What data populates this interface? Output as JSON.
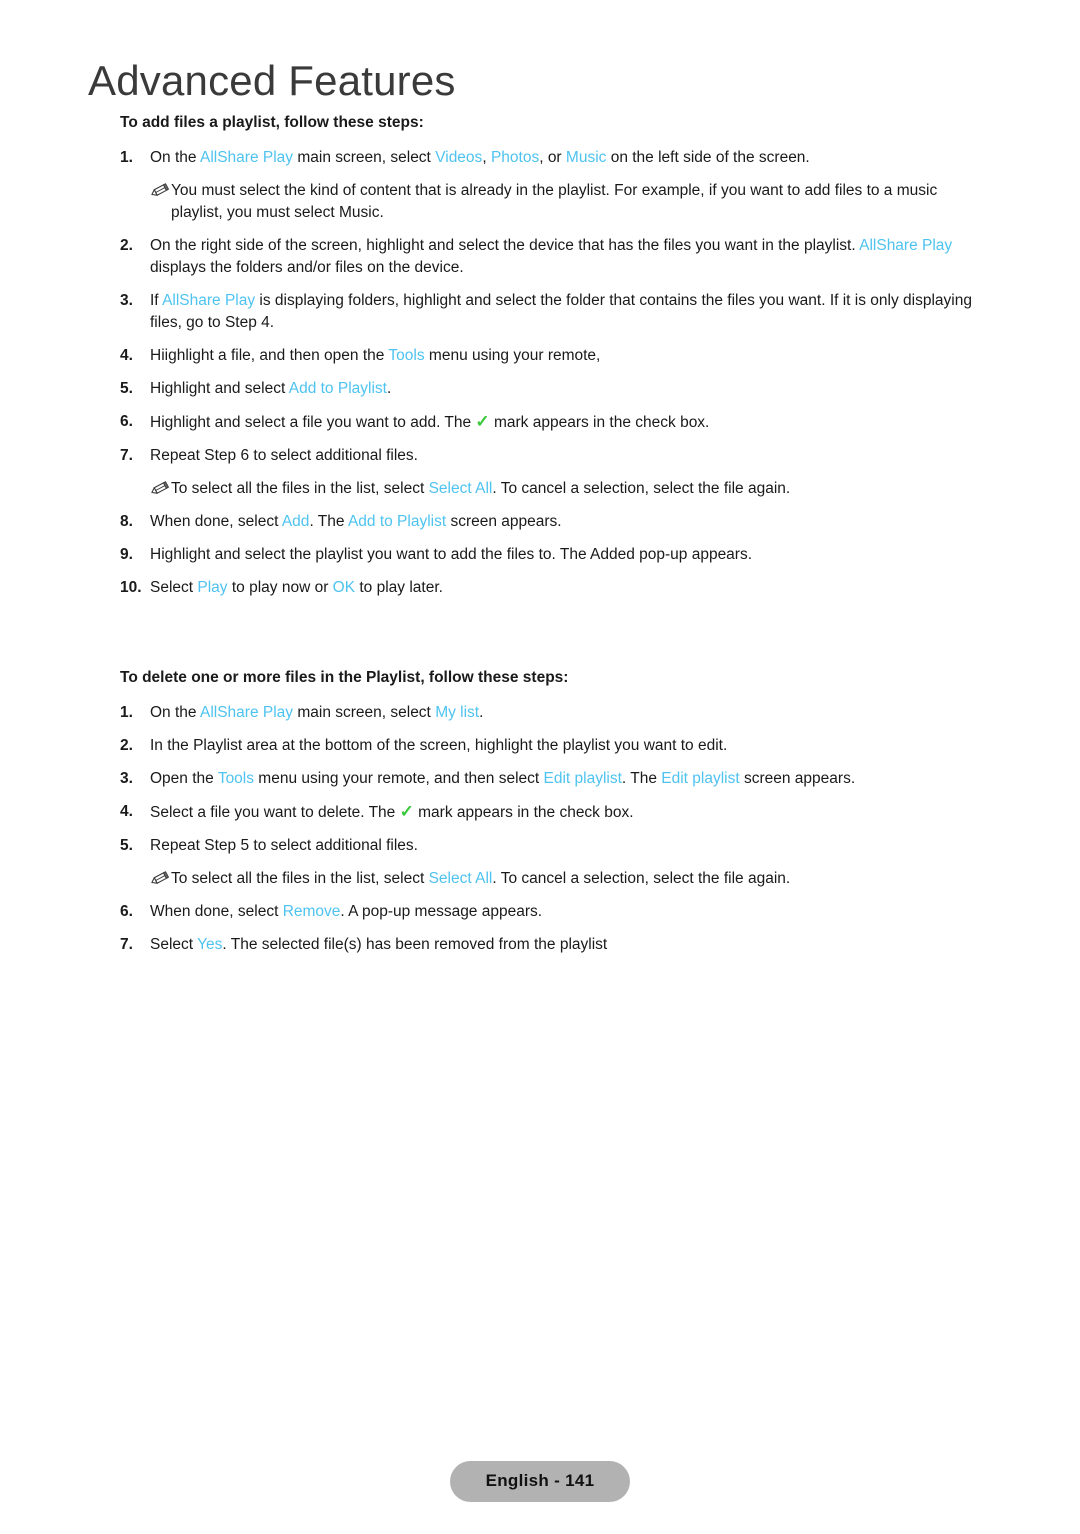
{
  "chapter": {
    "title": "Advanced Features"
  },
  "sections": [
    {
      "heading": "To add files a playlist, follow these steps:",
      "steps": [
        {
          "num": "1.",
          "parts": [
            {
              "t": "On the ",
              "c": "plain"
            },
            {
              "t": "AllShare Play",
              "c": "link"
            },
            {
              "t": " main screen, select ",
              "c": "plain"
            },
            {
              "t": "Videos",
              "c": "link"
            },
            {
              "t": ", ",
              "c": "plain"
            },
            {
              "t": "Photos",
              "c": "link"
            },
            {
              "t": ", or ",
              "c": "plain"
            },
            {
              "t": "Music",
              "c": "link"
            },
            {
              "t": " on the left side of the screen.",
              "c": "plain"
            }
          ]
        },
        {
          "note": true,
          "parts": [
            {
              "t": "You must select the kind of content that is already in the playlist. For example, if you want to add files to a music playlist, you must select Music.",
              "c": "plain"
            }
          ]
        },
        {
          "num": "2.",
          "parts": [
            {
              "t": "On the right side of the screen, highlight and select the device that has the files you want in the playlist. ",
              "c": "plain"
            },
            {
              "t": "AllShare Play",
              "c": "link"
            },
            {
              "t": " displays the folders and/or files on the device.",
              "c": "plain"
            }
          ]
        },
        {
          "num": "3.",
          "parts": [
            {
              "t": "If ",
              "c": "plain"
            },
            {
              "t": "AllShare Play",
              "c": "link"
            },
            {
              "t": " is displaying folders, highlight and select the folder that contains the files you want. If it is only displaying files, go to Step 4.",
              "c": "plain"
            }
          ]
        },
        {
          "num": "4.",
          "parts": [
            {
              "t": "Hiighlight a file, and then open the ",
              "c": "plain"
            },
            {
              "t": "Tools",
              "c": "link"
            },
            {
              "t": " menu using your remote,",
              "c": "plain"
            }
          ]
        },
        {
          "num": "5.",
          "parts": [
            {
              "t": "Highlight and select ",
              "c": "plain"
            },
            {
              "t": "Add to Playlist",
              "c": "link"
            },
            {
              "t": ".",
              "c": "plain"
            }
          ]
        },
        {
          "num": "6.",
          "parts": [
            {
              "t": "Highlight and select a file you want to add. The ",
              "c": "plain"
            },
            {
              "t": "✓",
              "c": "check"
            },
            {
              "t": " mark appears in the check box.",
              "c": "plain"
            }
          ]
        },
        {
          "num": "7.",
          "parts": [
            {
              "t": "Repeat Step 6 to select additional files.",
              "c": "plain"
            }
          ]
        },
        {
          "note": true,
          "parts": [
            {
              "t": "To select all the files in the list, select ",
              "c": "plain"
            },
            {
              "t": "Select All",
              "c": "link"
            },
            {
              "t": ". To cancel a selection, select the file again.",
              "c": "plain"
            }
          ]
        },
        {
          "num": "8.",
          "parts": [
            {
              "t": "When done, select ",
              "c": "plain"
            },
            {
              "t": "Add",
              "c": "link"
            },
            {
              "t": ". The ",
              "c": "plain"
            },
            {
              "t": "Add to Playlist",
              "c": "link"
            },
            {
              "t": " screen appears.",
              "c": "plain"
            }
          ]
        },
        {
          "num": "9.",
          "parts": [
            {
              "t": "Highlight and select the playlist you want to add the files to. The Added pop-up appears.",
              "c": "plain"
            }
          ]
        },
        {
          "num": "10.",
          "tight": true,
          "parts": [
            {
              "t": "Select ",
              "c": "plain"
            },
            {
              "t": "Play",
              "c": "link"
            },
            {
              "t": " to play now or ",
              "c": "plain"
            },
            {
              "t": "OK",
              "c": "link"
            },
            {
              "t": " to play later.",
              "c": "plain"
            }
          ]
        }
      ]
    },
    {
      "heading": "To delete one or more files in the Playlist, follow these steps:",
      "steps": [
        {
          "num": "1.",
          "parts": [
            {
              "t": "On the ",
              "c": "plain"
            },
            {
              "t": "AllShare Play",
              "c": "link"
            },
            {
              "t": " main screen, select ",
              "c": "plain"
            },
            {
              "t": "My list",
              "c": "link"
            },
            {
              "t": ".",
              "c": "plain"
            }
          ]
        },
        {
          "num": "2.",
          "parts": [
            {
              "t": "In the Playlist area at the bottom of the screen, highlight the playlist you want to edit.",
              "c": "plain"
            }
          ]
        },
        {
          "num": "3.",
          "parts": [
            {
              "t": "Open the ",
              "c": "plain"
            },
            {
              "t": "Tools",
              "c": "link"
            },
            {
              "t": " menu using your remote, and then select ",
              "c": "plain"
            },
            {
              "t": "Edit playlist",
              "c": "link"
            },
            {
              "t": ". The ",
              "c": "plain"
            },
            {
              "t": "Edit playlist",
              "c": "link"
            },
            {
              "t": " screen appears.",
              "c": "plain"
            }
          ]
        },
        {
          "num": "4.",
          "parts": [
            {
              "t": "Select a file you want to delete. The ",
              "c": "plain"
            },
            {
              "t": "✓",
              "c": "check"
            },
            {
              "t": " mark appears in the check box.",
              "c": "plain"
            }
          ]
        },
        {
          "num": "5.",
          "parts": [
            {
              "t": "Repeat Step 5 to select additional files.",
              "c": "plain"
            }
          ]
        },
        {
          "note": true,
          "parts": [
            {
              "t": "To select all the files in the list, select ",
              "c": "plain"
            },
            {
              "t": "Select All",
              "c": "link"
            },
            {
              "t": ". To cancel a selection, select the file again.",
              "c": "plain"
            }
          ]
        },
        {
          "num": "6.",
          "parts": [
            {
              "t": "When done, select ",
              "c": "plain"
            },
            {
              "t": "Remove",
              "c": "link"
            },
            {
              "t": ". A pop-up message appears.",
              "c": "plain"
            }
          ]
        },
        {
          "num": "7.",
          "parts": [
            {
              "t": "Select ",
              "c": "plain"
            },
            {
              "t": "Yes",
              "c": "link"
            },
            {
              "t": ". The selected file(s) has been removed from the playlist",
              "c": "plain"
            }
          ]
        }
      ]
    }
  ],
  "footer": {
    "page_label": "English - 141"
  },
  "colors": {
    "link": "#4ec3f0",
    "check": "#3cc83c",
    "badge_bg": "#b2b2b2",
    "text": "#1a1a1a"
  }
}
